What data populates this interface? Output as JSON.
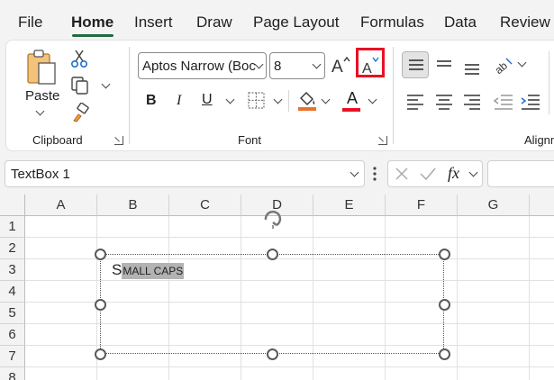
{
  "tabs": [
    {
      "label": "File"
    },
    {
      "label": "Home"
    },
    {
      "label": "Insert"
    },
    {
      "label": "Draw"
    },
    {
      "label": "Page Layout"
    },
    {
      "label": "Formulas"
    },
    {
      "label": "Data"
    },
    {
      "label": "Review"
    }
  ],
  "active_tab": "Home",
  "clipboard": {
    "paste_label": "Paste",
    "group_label": "Clipboard"
  },
  "font": {
    "font_name": "Aptos Narrow (Boc",
    "font_size": "8",
    "bold_label": "B",
    "italic_label": "I",
    "underline_label": "U",
    "font_color_letter": "A",
    "group_label": "Font",
    "highlight_color": "#e8732c",
    "font_color": "#e81123",
    "highlighted_button": "decrease-font-size-button",
    "highlight_box_color": "#e81123"
  },
  "alignment": {
    "group_label": "Alignm"
  },
  "formula_bar": {
    "name_box": "TextBox 1",
    "fx_label": "fx",
    "formula_value": ""
  },
  "columns": [
    "A",
    "B",
    "C",
    "D",
    "E",
    "F",
    "G"
  ],
  "rows": [
    "1",
    "2",
    "3",
    "4",
    "5",
    "6",
    "7",
    "8"
  ],
  "textbox": {
    "first_char": "S",
    "rest": "MALL CAPS"
  },
  "colors": {
    "accent": "#1f6b3f",
    "ribbon_bg": "#ffffff",
    "app_bg": "#f3f3f3"
  }
}
